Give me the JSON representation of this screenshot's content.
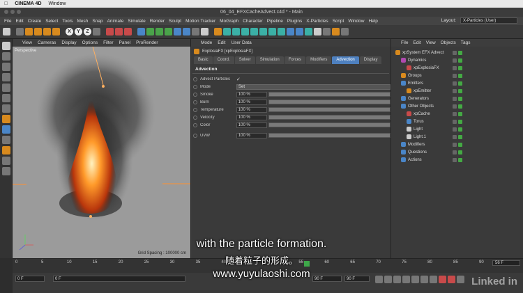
{
  "os_menu": {
    "app": "CINEMA 4D",
    "window": "Window"
  },
  "window_title": "06_04_EFXCacheAdvect.c4d * - Main",
  "menu": [
    "File",
    "Edit",
    "Create",
    "Select",
    "Tools",
    "Mesh",
    "Snap",
    "Animate",
    "Simulate",
    "Render",
    "Sculpt",
    "Motion Tracker",
    "MoGraph",
    "Character",
    "Pipeline",
    "Plugins",
    "X-Particles",
    "Script",
    "Window",
    "Help"
  ],
  "layout": {
    "label": "Layout:",
    "value": "X-Particles (User)"
  },
  "toolbar_axes": [
    "X",
    "Y",
    "Z"
  ],
  "viewport": {
    "menu": [
      "View",
      "Cameras",
      "Display",
      "Options",
      "Filter",
      "Panel",
      "ProRender"
    ],
    "label": "Perspective",
    "grid_spacing": "Grid Spacing : 100000 cm"
  },
  "attributes": {
    "menu": [
      "Mode",
      "Edit",
      "User Data"
    ],
    "object_name": "ExplosiaFX [xpExplosiaFX]",
    "tabs": [
      "Basic",
      "Coord.",
      "Solver",
      "Simulation",
      "Forces",
      "Modifiers",
      "Advection",
      "Display"
    ],
    "active_tab": "Advection",
    "section": "Advection",
    "advect_particles": {
      "label": "Advect Particles",
      "check": "✓"
    },
    "mode": {
      "label": "Mode",
      "value": "Set"
    },
    "params": [
      {
        "label": "Smoke",
        "value": "100 %"
      },
      {
        "label": "Burn",
        "value": "100 %"
      },
      {
        "label": "Temperature",
        "value": "100 %"
      },
      {
        "label": "Velocity",
        "value": "100 %"
      },
      {
        "label": "Color",
        "value": "100 %"
      }
    ],
    "uvw": {
      "label": "UVW",
      "value": "100 %"
    }
  },
  "objects": {
    "menu": [
      "File",
      "Edit",
      "View",
      "Objects",
      "Tags"
    ],
    "items": [
      {
        "name": "xpSystem EFX Advect",
        "indent": 0,
        "color": "#d88a1e"
      },
      {
        "name": "Dynamics",
        "indent": 1,
        "color": "#b04ab0"
      },
      {
        "name": "xpExplosiaFX",
        "indent": 2,
        "color": "#c84a4a"
      },
      {
        "name": "Groups",
        "indent": 1,
        "color": "#d88a1e"
      },
      {
        "name": "Emitters",
        "indent": 1,
        "color": "#4a86c8"
      },
      {
        "name": "xpEmitter",
        "indent": 2,
        "color": "#d88a1e"
      },
      {
        "name": "Generators",
        "indent": 1,
        "color": "#4a86c8"
      },
      {
        "name": "Other Objects",
        "indent": 1,
        "color": "#4a86c8"
      },
      {
        "name": "xpCache",
        "indent": 2,
        "color": "#c84a4a"
      },
      {
        "name": "Torus",
        "indent": 2,
        "color": "#4a86c8"
      },
      {
        "name": "Light",
        "indent": 2,
        "color": "#cccccc"
      },
      {
        "name": "Light.1",
        "indent": 2,
        "color": "#cccccc"
      },
      {
        "name": "Modifiers",
        "indent": 1,
        "color": "#4a86c8"
      },
      {
        "name": "Questions",
        "indent": 1,
        "color": "#4a86c8"
      },
      {
        "name": "Actions",
        "indent": 1,
        "color": "#4a86c8"
      }
    ]
  },
  "timeline": {
    "ticks": [
      "0",
      "5",
      "10",
      "15",
      "20",
      "25",
      "30",
      "35",
      "40",
      "45",
      "50",
      "55",
      "60",
      "65",
      "70",
      "75",
      "80",
      "85",
      "90"
    ],
    "current_frame": "56",
    "end_frame": "56 F"
  },
  "transport": {
    "start": "0 F",
    "current": "0 F",
    "end": "90 F",
    "max": "90 F"
  },
  "overlay": {
    "subtitle_en": "with the particle formation.",
    "subtitle_zh": "随着粒子的形成。",
    "watermark": "www.yuyulaoshi.com",
    "brand": "Linked in"
  },
  "colors": {
    "accent": "#4e80bf",
    "fire": "#ff7a1a",
    "playhead": "#3ea84a"
  }
}
